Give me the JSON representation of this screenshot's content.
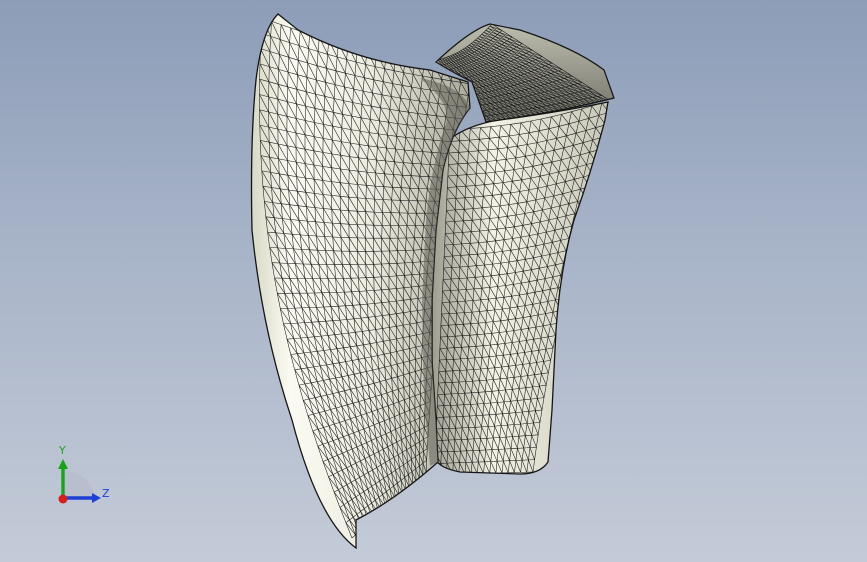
{
  "viewport": {
    "background_top": "#8d9db8",
    "background_bottom": "#c4cbd8",
    "model": {
      "name": "twisted-blade-mesh",
      "face_color": "#f1f1e4",
      "shade_color": "#b9b9aa",
      "edge_color": "#151515"
    }
  },
  "triad": {
    "y_label": "Y",
    "z_label": "Z",
    "y_color": "#1aa31a",
    "z_color": "#1e3fd6",
    "x_color": "#d61e1e"
  }
}
